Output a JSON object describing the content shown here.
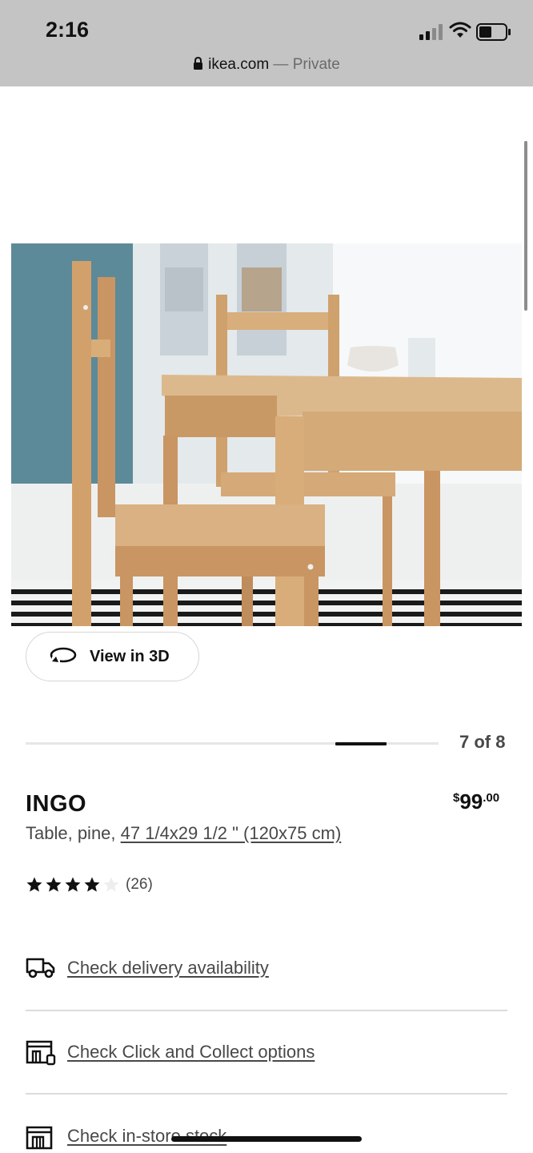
{
  "status_bar": {
    "time": "2:16",
    "url": "ikea.com",
    "url_separator": " — ",
    "mode": "Private"
  },
  "gallery": {
    "view_3d_label": "View in 3D",
    "pager_text": "7 of 8"
  },
  "product": {
    "name": "INGO",
    "price_currency": "$",
    "price_integer": "99",
    "price_decimal": ".00",
    "description_prefix": "Table, pine, ",
    "description_size": "47 1/4x29 1/2 \" (120x75 cm)",
    "rating": 4,
    "rating_max": 5,
    "review_count": "(26)"
  },
  "options": [
    {
      "label": "Check delivery availability",
      "icon": "delivery-truck-icon"
    },
    {
      "label": "Check Click and Collect options",
      "icon": "click-collect-store-icon"
    },
    {
      "label": "Check in-store stock",
      "icon": "store-icon"
    }
  ],
  "colors": {
    "status_bar_bg": "#c4c4c4",
    "text_primary": "#111111",
    "text_secondary": "#484848"
  }
}
